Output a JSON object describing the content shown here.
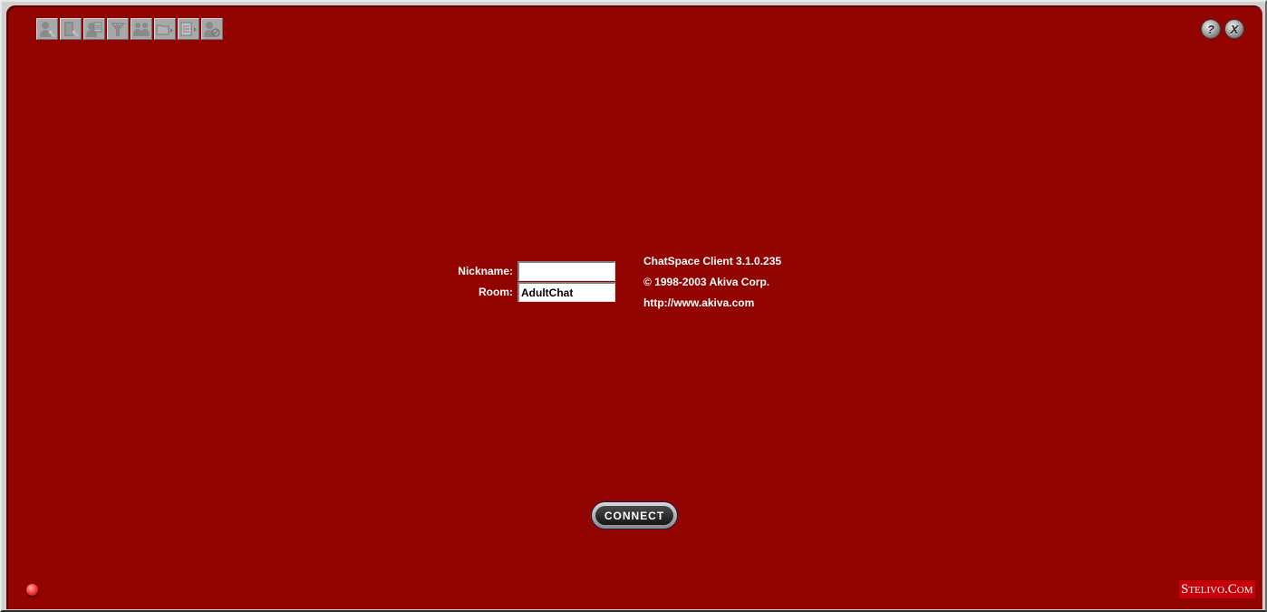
{
  "toolbar": {
    "buttons": [
      {
        "name": "user-settings-icon",
        "label": "User Settings"
      },
      {
        "name": "room-settings-icon",
        "label": "Room Settings"
      },
      {
        "name": "user-info-icon",
        "label": "User Info"
      },
      {
        "name": "filter-icon",
        "label": "Filter"
      },
      {
        "name": "users-icon",
        "label": "Users"
      },
      {
        "name": "send-file-icon",
        "label": "Send File"
      },
      {
        "name": "notes-icon",
        "label": "Notes"
      },
      {
        "name": "ignore-user-icon",
        "label": "Ignore User"
      }
    ]
  },
  "window_controls": {
    "help_glyph": "?",
    "close_glyph": "X"
  },
  "login": {
    "nickname_label": "Nickname:",
    "nickname_value": "",
    "room_label": "Room:",
    "room_value": "AdultChat"
  },
  "info": {
    "version": "ChatSpace Client 3.1.0.235",
    "copyright": "© 1998-2003 Akiva Corp.",
    "url": "http://www.akiva.com"
  },
  "connect_label": "CONNECT",
  "status": {
    "indicator": "disconnected",
    "color": "#ff4040"
  },
  "branding": "Stelivo.Com",
  "colors": {
    "background": "#920400",
    "text": "#ffffff"
  }
}
